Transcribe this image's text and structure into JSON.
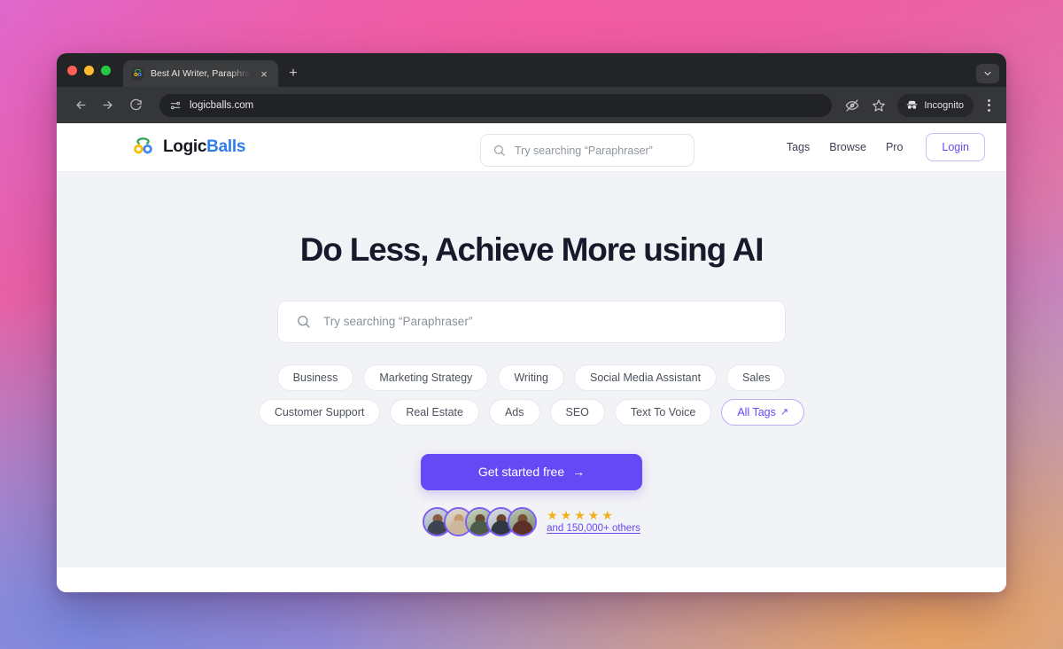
{
  "browser": {
    "tab": {
      "title": "Best AI Writer, Paraphrasing & ...",
      "favicon_name": "logicballs-favicon",
      "close_label": "×"
    },
    "new_tab_label": "+",
    "window_chevron_name": "chevron-down-icon",
    "toolbar": {
      "back_name": "back-arrow-icon",
      "forward_name": "forward-arrow-icon",
      "reload_name": "reload-icon",
      "site_info_name": "site-settings-icon",
      "url": "logicballs.com",
      "tracking_protection_name": "eye-slash-icon",
      "bookmark_name": "star-icon",
      "incognito_label": "Incognito",
      "incognito_icon_name": "incognito-hat-icon",
      "menu_name": "kebab-menu-icon"
    }
  },
  "site": {
    "brand": {
      "name_first": "Logic",
      "name_second": "Balls"
    },
    "header_search": {
      "placeholder": "Try searching “Paraphraser”"
    },
    "nav": [
      {
        "label": "Tags"
      },
      {
        "label": "Browse"
      },
      {
        "label": "Pro"
      }
    ],
    "login_label": "Login",
    "hero": {
      "title": "Do Less, Achieve More using AI",
      "search_placeholder": "Try searching “Paraphraser”",
      "tag_rows": [
        [
          "Business",
          "Marketing Strategy",
          "Writing",
          "Social Media Assistant",
          "Sales"
        ],
        [
          "Customer Support",
          "Real Estate",
          "Ads",
          "SEO",
          "Text To Voice"
        ]
      ],
      "all_tags_label": "All Tags",
      "all_tags_arrow": "↗",
      "cta_label": "Get started free",
      "cta_arrow": "→",
      "social_proof": {
        "stars": [
          "★",
          "★",
          "★",
          "★",
          "★"
        ],
        "link_label": "and 150,000+ others",
        "avatar_count": 5
      }
    }
  },
  "colors": {
    "accent_purple": "#6449f5",
    "brand_blue": "#2f7ced",
    "star_gold": "#f2b01e",
    "hero_bg": "#f2f3f6",
    "heading": "#161a2b"
  }
}
